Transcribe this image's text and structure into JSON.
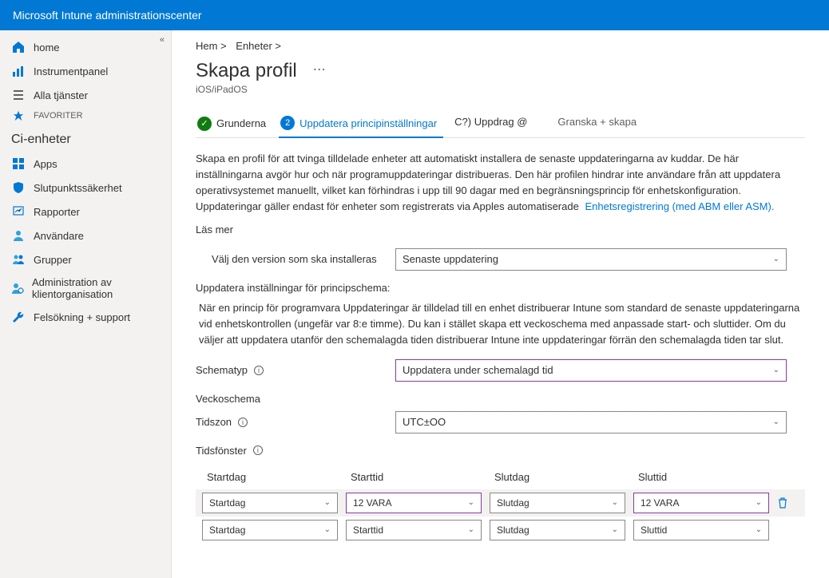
{
  "header": {
    "title": "Microsoft Intune administrationscenter"
  },
  "sidebar": {
    "global": [
      {
        "label": "home"
      },
      {
        "label": "Instrumentpanel"
      },
      {
        "label": "Alla tjänster"
      }
    ],
    "favorites_label": "FAVORITER",
    "section_title": "Ci-enheter",
    "items": [
      {
        "label": "Apps"
      },
      {
        "label": "Slutpunktssäkerhet"
      },
      {
        "label": "Rapporter"
      },
      {
        "label": "Användare"
      },
      {
        "label": "Grupper"
      },
      {
        "label": "Administration av klientorganisation"
      },
      {
        "label": "Felsökning + support"
      }
    ]
  },
  "breadcrumb": {
    "a": "Hem >",
    "b": "Enheter >"
  },
  "page": {
    "title": "Skapa profil",
    "subtitle": "iOS/iPadOS",
    "steps": {
      "s1": "Grunderna",
      "s2": "Uppdatera principinställningar",
      "s3": "C?) Uppdrag @",
      "s4": "Granska + skapa"
    },
    "desc1": "Skapa en profil för att tvinga tilldelade enheter att automatiskt installera de senaste uppdateringarna av kuddar. De här inställningarna avgör hur och när programuppdateringar distribueras. Den här profilen hindrar inte användare från att uppdatera operativsystemet manuellt, vilket kan förhindras i upp till 90 dagar med en begränsningsprincip för enhetskonfiguration. Uppdateringar gäller endast för enheter som registrerats via Apples automatiserade",
    "desc1_link": "Enhetsregistrering (med ABM eller ASM).",
    "learn_more": "Läs mer",
    "select_version_label": "Välj den version som ska installeras",
    "select_version_value": "Senaste uppdatering",
    "schedule_heading": "Uppdatera inställningar för principschema:",
    "schedule_desc": "När en princip för programvara Uppdateringar är tilldelad till en enhet distribuerar Intune som standard de senaste uppdateringarna vid enhetskontrollen (ungefär var 8:e timme). Du kan i stället skapa ett veckoschema med anpassade start- och sluttider. Om du väljer att uppdatera utanför den schemalagda tiden distribuerar Intune inte uppdateringar förrän den schemalagda tiden tar slut.",
    "schedule_type_label": "Schematyp",
    "schedule_type_value": "Uppdatera under schemalagd tid",
    "week_heading": "Veckoschema",
    "timezone_label": "Tidszon",
    "timezone_value": "UTC±OO",
    "windows_label": "Tidsfönster",
    "cols": {
      "c1": "Startdag",
      "c2": "Starttid",
      "c3": "Slutdag",
      "c4": "Sluttid"
    },
    "rows": [
      {
        "startdag": "Startdag",
        "starttid": "12 VARA",
        "slutdag": "Slutdag",
        "sluttid": "12 VARA"
      },
      {
        "startdag": "Startdag",
        "starttid": "Starttid",
        "slutdag": "Slutdag",
        "sluttid": "Sluttid"
      }
    ]
  }
}
